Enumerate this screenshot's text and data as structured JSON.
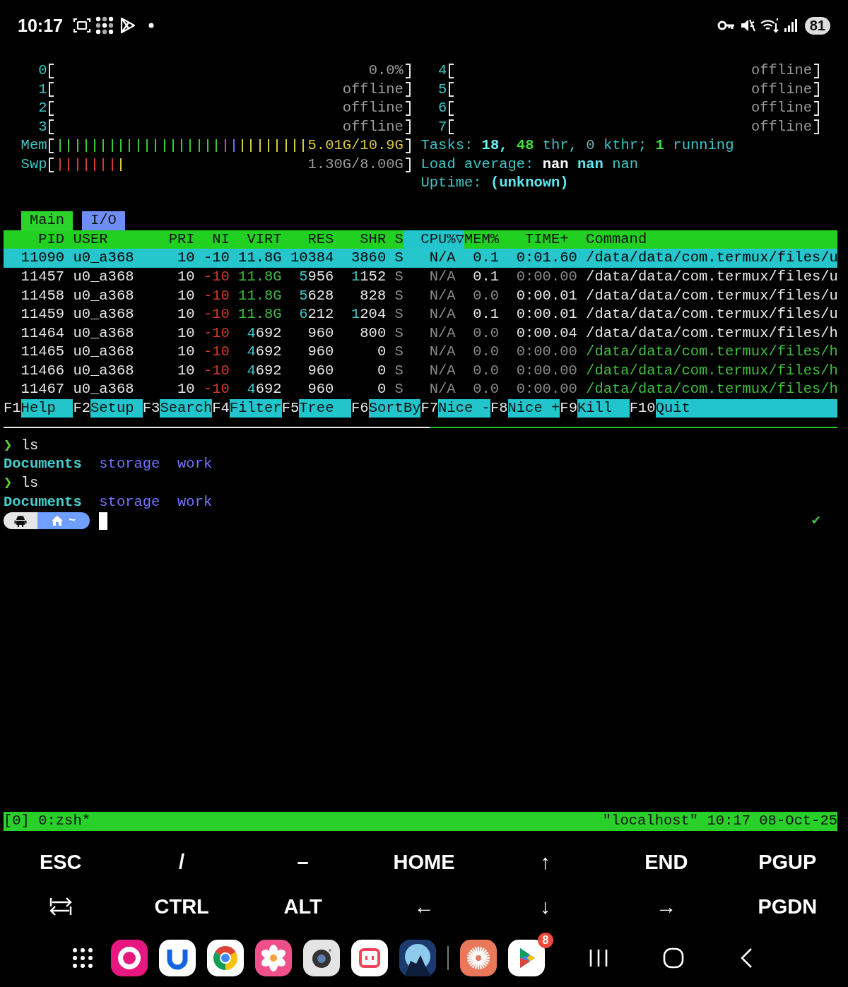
{
  "status_bar": {
    "time": "10:17",
    "battery": "81"
  },
  "htop": {
    "cpu_meters": [
      {
        "label": "0",
        "reading": "0.0%"
      },
      {
        "label": "1",
        "reading": "offline"
      },
      {
        "label": "2",
        "reading": "offline"
      },
      {
        "label": "3",
        "reading": "offline"
      },
      {
        "label": "4",
        "reading": "offline"
      },
      {
        "label": "5",
        "reading": "offline"
      },
      {
        "label": "6",
        "reading": "offline"
      },
      {
        "label": "7",
        "reading": "offline"
      }
    ],
    "memory_meters": [
      {
        "label": "Mem",
        "reading": "5.01G/10.9G",
        "color": "#d8c840",
        "bars": [
          {
            "color": "#3cc83c"
          },
          {
            "color": "#3cc83c"
          },
          {
            "color": "#3cc83c"
          },
          {
            "color": "#3cc83c"
          },
          {
            "color": "#3cc83c"
          },
          {
            "color": "#3cc83c"
          },
          {
            "color": "#3cc83c"
          },
          {
            "color": "#3cc83c"
          },
          {
            "color": "#3cc83c"
          },
          {
            "color": "#3cc83c"
          },
          {
            "color": "#3cc83c"
          },
          {
            "color": "#3cc83c"
          },
          {
            "color": "#3cc83c"
          },
          {
            "color": "#3cc83c"
          },
          {
            "color": "#3cc83c"
          },
          {
            "color": "#3cc83c"
          },
          {
            "color": "#3cc83c"
          },
          {
            "color": "#3cc83c"
          },
          {
            "color": "#3cc83c"
          },
          {
            "color": "#c050c0"
          },
          {
            "color": "#6b6bff"
          },
          {
            "color": "#d8c840"
          },
          {
            "color": "#d8c840"
          },
          {
            "color": "#d8c840"
          },
          {
            "color": "#d8c840"
          },
          {
            "color": "#d8c840"
          },
          {
            "color": "#d8c840"
          },
          {
            "color": "#d8c840"
          },
          {
            "color": "#d8c840"
          }
        ]
      },
      {
        "label": "Swp",
        "reading": "1.30G/8.00G",
        "color": "#9a9a9a",
        "bars": [
          {
            "color": "#d03a30"
          },
          {
            "color": "#d03a30"
          },
          {
            "color": "#d03a30"
          },
          {
            "color": "#d03a30"
          },
          {
            "color": "#d03a30"
          },
          {
            "color": "#d03a30"
          },
          {
            "color": "#d03a30"
          },
          {
            "color": "#d8c840"
          }
        ]
      }
    ],
    "tasks": [
      {
        "text": "Tasks:",
        "kind": "label"
      },
      {
        "text": "18,",
        "kind": "total"
      },
      {
        "text": "48",
        "kind": "threads"
      },
      {
        "text": "thr,",
        "kind": "label"
      },
      {
        "text": "0",
        "kind": "kernel_threads"
      },
      {
        "text": "kthr;",
        "kind": "label"
      },
      {
        "text": "1",
        "kind": "running"
      },
      {
        "text": "running",
        "kind": "label"
      }
    ],
    "load_average": [
      {
        "text": "Load average:",
        "kind": "label"
      },
      {
        "text": "nan",
        "kind": "load_1"
      },
      {
        "text": "nan",
        "kind": "load_5"
      },
      {
        "text": "nan",
        "kind": "load_15"
      }
    ],
    "uptime": [
      {
        "text": "Uptime:",
        "kind": "label"
      },
      {
        "text": "(unknown)",
        "kind": "uptime"
      }
    ],
    "tabs": [
      {
        "label": "Main",
        "selected": true
      },
      {
        "label": "I/O",
        "selected": false
      }
    ],
    "columns": [
      {
        "label": "PID",
        "sorted": false
      },
      {
        "label": "USER",
        "sorted": false
      },
      {
        "label": "PRI",
        "sorted": false
      },
      {
        "label": "NI",
        "sorted": false
      },
      {
        "label": "VIRT",
        "sorted": false
      },
      {
        "label": "RES",
        "sorted": false
      },
      {
        "label": "SHR",
        "sorted": false
      },
      {
        "label": "S",
        "sorted": false
      },
      {
        "label": "CPU%▽",
        "sorted": true
      },
      {
        "label": "MEM%",
        "sorted": false
      },
      {
        "label": "TIME+",
        "sorted": false
      },
      {
        "label": "Command",
        "sorted": false
      }
    ],
    "processes": [
      {
        "selected": true,
        "cells": [
          "11090",
          "u0_a368",
          "10",
          "-10",
          "11.8G",
          "10384",
          "3860",
          "S",
          "N/A",
          "0.1",
          "0:01.60",
          "/data/data/com.termux/files/u"
        ]
      },
      {
        "selected": false,
        "cells": [
          "11457",
          "u0_a368",
          "10",
          [
            {
              "text": "-10",
              "kind": "negative"
            }
          ],
          [
            {
              "text": "11.8G",
              "kind": "giga"
            }
          ],
          [
            {
              "text": "5",
              "kind": "large"
            },
            {
              "text": "956",
              "kind": "normal"
            }
          ],
          [
            {
              "text": "1",
              "kind": "large"
            },
            {
              "text": "152",
              "kind": "normal"
            }
          ],
          [
            {
              "text": "S",
              "kind": "dim"
            }
          ],
          [
            {
              "text": "N/A",
              "kind": "dim"
            }
          ],
          "0.1",
          [
            {
              "text": "0:00.00",
              "kind": "dim"
            }
          ],
          "/data/data/com.termux/files/u"
        ]
      },
      {
        "selected": false,
        "cells": [
          "11458",
          "u0_a368",
          "10",
          [
            {
              "text": "-10",
              "kind": "negative"
            }
          ],
          [
            {
              "text": "11.8G",
              "kind": "giga"
            }
          ],
          [
            {
              "text": "5",
              "kind": "large"
            },
            {
              "text": "628",
              "kind": "normal"
            }
          ],
          "828",
          [
            {
              "text": "S",
              "kind": "dim"
            }
          ],
          [
            {
              "text": "N/A",
              "kind": "dim"
            }
          ],
          [
            {
              "text": "0.0",
              "kind": "dim"
            }
          ],
          "0:00.01",
          "/data/data/com.termux/files/u"
        ]
      },
      {
        "selected": false,
        "cells": [
          "11459",
          "u0_a368",
          "10",
          [
            {
              "text": "-10",
              "kind": "negative"
            }
          ],
          [
            {
              "text": "11.8G",
              "kind": "giga"
            }
          ],
          [
            {
              "text": "6",
              "kind": "large"
            },
            {
              "text": "212",
              "kind": "normal"
            }
          ],
          [
            {
              "text": "1",
              "kind": "large"
            },
            {
              "text": "204",
              "kind": "normal"
            }
          ],
          [
            {
              "text": "S",
              "kind": "dim"
            }
          ],
          [
            {
              "text": "N/A",
              "kind": "dim"
            }
          ],
          "0.1",
          "0:00.01",
          "/data/data/com.termux/files/u"
        ]
      },
      {
        "selected": false,
        "cells": [
          "11464",
          "u0_a368",
          "10",
          [
            {
              "text": "-10",
              "kind": "negative"
            }
          ],
          [
            {
              "text": "4",
              "kind": "large"
            },
            {
              "text": "692",
              "kind": "normal"
            }
          ],
          "960",
          "800",
          [
            {
              "text": "S",
              "kind": "dim"
            }
          ],
          [
            {
              "text": "N/A",
              "kind": "dim"
            }
          ],
          [
            {
              "text": "0.0",
              "kind": "dim"
            }
          ],
          "0:00.04",
          "/data/data/com.termux/files/h"
        ]
      },
      {
        "selected": false,
        "cells": [
          "11465",
          "u0_a368",
          "10",
          [
            {
              "text": "-10",
              "kind": "negative"
            }
          ],
          [
            {
              "text": "4",
              "kind": "large"
            },
            {
              "text": "692",
              "kind": "normal"
            }
          ],
          "960",
          "0",
          [
            {
              "text": "S",
              "kind": "dim"
            }
          ],
          [
            {
              "text": "N/A",
              "kind": "dim"
            }
          ],
          [
            {
              "text": "0.0",
              "kind": "dim"
            }
          ],
          [
            {
              "text": "0:00.00",
              "kind": "dim"
            }
          ],
          [
            {
              "text": "/data/data/com.termux/files/h",
              "kind": "thread"
            }
          ]
        ]
      },
      {
        "selected": false,
        "cells": [
          "11466",
          "u0_a368",
          "10",
          [
            {
              "text": "-10",
              "kind": "negative"
            }
          ],
          [
            {
              "text": "4",
              "kind": "large"
            },
            {
              "text": "692",
              "kind": "normal"
            }
          ],
          "960",
          "0",
          [
            {
              "text": "S",
              "kind": "dim"
            }
          ],
          [
            {
              "text": "N/A",
              "kind": "dim"
            }
          ],
          [
            {
              "text": "0.0",
              "kind": "dim"
            }
          ],
          [
            {
              "text": "0:00.00",
              "kind": "dim"
            }
          ],
          [
            {
              "text": "/data/data/com.termux/files/h",
              "kind": "thread"
            }
          ]
        ]
      },
      {
        "selected": false,
        "cells": [
          "11467",
          "u0_a368",
          "10",
          [
            {
              "text": "-10",
              "kind": "negative"
            }
          ],
          [
            {
              "text": "4",
              "kind": "large"
            },
            {
              "text": "692",
              "kind": "normal"
            }
          ],
          "960",
          "0",
          [
            {
              "text": "S",
              "kind": "dim"
            }
          ],
          [
            {
              "text": "N/A",
              "kind": "dim"
            }
          ],
          [
            {
              "text": "0.0",
              "kind": "dim"
            }
          ],
          [
            {
              "text": "0:00.00",
              "kind": "dim"
            }
          ],
          [
            {
              "text": "/data/data/com.termux/files/h",
              "kind": "thread"
            }
          ]
        ]
      }
    ],
    "function_keys": [
      {
        "key": "F1",
        "label": "Help"
      },
      {
        "key": "F2",
        "label": "Setup"
      },
      {
        "key": "F3",
        "label": "Search"
      },
      {
        "key": "F4",
        "label": "Filter"
      },
      {
        "key": "F5",
        "label": "Tree"
      },
      {
        "key": "F6",
        "label": "SortBy"
      },
      {
        "key": "F7",
        "label": "Nice -"
      },
      {
        "key": "F8",
        "label": "Nice +"
      },
      {
        "key": "F9",
        "label": "Kill"
      },
      {
        "key": "F10",
        "label": "Quit"
      }
    ]
  },
  "shell": {
    "history": [
      {
        "prompt": "❯",
        "command": "ls",
        "output": [
          {
            "text": "Documents",
            "kind": "directory"
          },
          {
            "text": "storage",
            "kind": "link"
          },
          {
            "text": "work",
            "kind": "link"
          }
        ]
      },
      {
        "prompt": "❯",
        "command": "ls",
        "output": [
          {
            "text": "Documents",
            "kind": "directory"
          },
          {
            "text": "storage",
            "kind": "link"
          },
          {
            "text": "work",
            "kind": "link"
          }
        ]
      }
    ],
    "prompt_path": "~",
    "exit_status": "✔"
  },
  "tmux_status": {
    "left": "[0] 0:zsh*",
    "right": "\"localhost\" 10:17 08-Oct-25"
  },
  "extra_keys": [
    [
      {
        "kind": "text",
        "label": "ESC"
      },
      {
        "kind": "text",
        "label": "/"
      },
      {
        "kind": "text",
        "label": "–"
      },
      {
        "kind": "text",
        "label": "HOME"
      },
      {
        "kind": "text",
        "label": "↑"
      },
      {
        "kind": "text",
        "label": "END"
      },
      {
        "kind": "text",
        "label": "PGUP"
      }
    ],
    [
      {
        "kind": "tab"
      },
      {
        "kind": "text",
        "label": "CTRL"
      },
      {
        "kind": "text",
        "label": "ALT"
      },
      {
        "kind": "text",
        "label": "←"
      },
      {
        "kind": "text",
        "label": "↓"
      },
      {
        "kind": "text",
        "label": "→"
      },
      {
        "kind": "text",
        "label": "PGDN"
      }
    ]
  ],
  "dock": {
    "last_app_badge": "8"
  }
}
